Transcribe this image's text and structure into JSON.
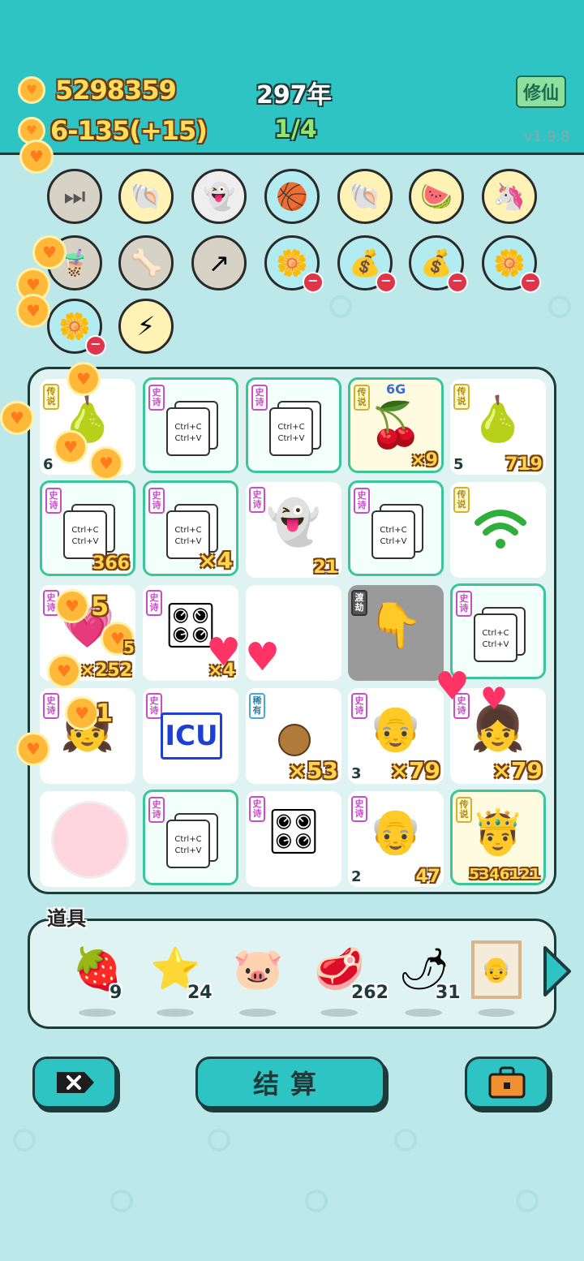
{
  "header": {
    "coins": "5298359",
    "income": "6-135(+15)",
    "year": "297年",
    "progress": "1/4",
    "xiuxian_label": "修仙",
    "version": "v1.9.8"
  },
  "icons_row1": [
    "skip-icon",
    "shell-icon",
    "ghost-icon",
    "basketballs-icon",
    "shell-icon",
    "fruits-icon",
    "unicorn-icon"
  ],
  "icons_row2": [
    "bubble-tea-icon",
    "dog-bowl-icon",
    "arrow-card-icon",
    "flower-pot-icon",
    "money-bag-icon",
    "money-bag-icon",
    "flower-pot-icon"
  ],
  "icons_row3": [
    "flower-pot-icon",
    "lightning-icon"
  ],
  "grid": {
    "r0": [
      {
        "tag": "传说",
        "level": "6",
        "count": "",
        "item": "pear"
      },
      {
        "tag": "史诗",
        "level": "",
        "count": "",
        "item": "ctrl-c-v"
      },
      {
        "tag": "史诗",
        "level": "",
        "count": "",
        "item": "ctrl-c-v"
      },
      {
        "tag": "传说",
        "level": "",
        "count": "×9",
        "item": "6g-lychee",
        "extra": "6G"
      },
      {
        "tag": "传说",
        "level": "5",
        "count": "719",
        "item": "pear"
      }
    ],
    "r1": [
      {
        "tag": "史诗",
        "level": "",
        "count": "366",
        "item": "ctrl-c-v"
      },
      {
        "tag": "史诗",
        "level": "",
        "count": "×4",
        "item": "ctrl-c-v"
      },
      {
        "tag": "史诗",
        "level": "",
        "count": "21",
        "item": "dead-ghost"
      },
      {
        "tag": "史诗",
        "level": "",
        "count": "",
        "item": "ctrl-c-v"
      },
      {
        "tag": "传说",
        "level": "",
        "count": "",
        "item": "wifi"
      }
    ],
    "r2": [
      {
        "tag": "史诗",
        "level": "",
        "count": "×252",
        "item": "hearts"
      },
      {
        "tag": "史诗",
        "level": "",
        "count": "×4",
        "item": "gpu"
      },
      {
        "tag": "",
        "level": "",
        "count": "",
        "item": "empty"
      },
      {
        "tag": "渡劫",
        "level": "",
        "count": "",
        "item": "pointing-hand"
      },
      {
        "tag": "史诗",
        "level": "",
        "count": "",
        "item": "ctrl-c-v"
      }
    ],
    "r3": [
      {
        "tag": "史诗",
        "level": "",
        "count": "",
        "item": "girl"
      },
      {
        "tag": "史诗",
        "level": "",
        "count": "",
        "item": "icu",
        "text": "ICU"
      },
      {
        "tag": "稀有",
        "level": "",
        "count": "×53",
        "item": "nut"
      },
      {
        "tag": "史诗",
        "level": "3",
        "count": "×79",
        "item": "old-man"
      },
      {
        "tag": "史诗",
        "level": "",
        "count": "×79",
        "item": "girl"
      }
    ],
    "r4": [
      {
        "tag": "",
        "level": "",
        "count": "",
        "item": "gumball"
      },
      {
        "tag": "史诗",
        "level": "",
        "count": "",
        "item": "ctrl-c-v"
      },
      {
        "tag": "史诗",
        "level": "",
        "count": "",
        "item": "gpu"
      },
      {
        "tag": "史诗",
        "level": "2",
        "count": "47",
        "item": "old-man"
      },
      {
        "tag": "传说",
        "level": "",
        "count": "5346121",
        "item": "king"
      }
    ]
  },
  "float_texts": {
    "a": "5",
    "b": "5",
    "c": "1"
  },
  "ctrl_text": {
    "line1": "Ctrl+C",
    "line2": "Ctrl+V"
  },
  "items_title": "道具",
  "items": [
    {
      "name": "lychee-icon",
      "count": "9"
    },
    {
      "name": "star-icon",
      "count": "24"
    },
    {
      "name": "piggy-bank-icon",
      "count": ""
    },
    {
      "name": "liver-icon",
      "count": "262"
    },
    {
      "name": "chili-icon",
      "count": "31"
    },
    {
      "name": "portrait-icon",
      "count": ""
    }
  ],
  "buttons": {
    "settle": "结算"
  },
  "colors": {
    "header": "#2ec4c4",
    "coin": "#ffb93a",
    "epic": "#c84ec8",
    "legend": "#d4b12c",
    "rare": "#46a7d8"
  }
}
